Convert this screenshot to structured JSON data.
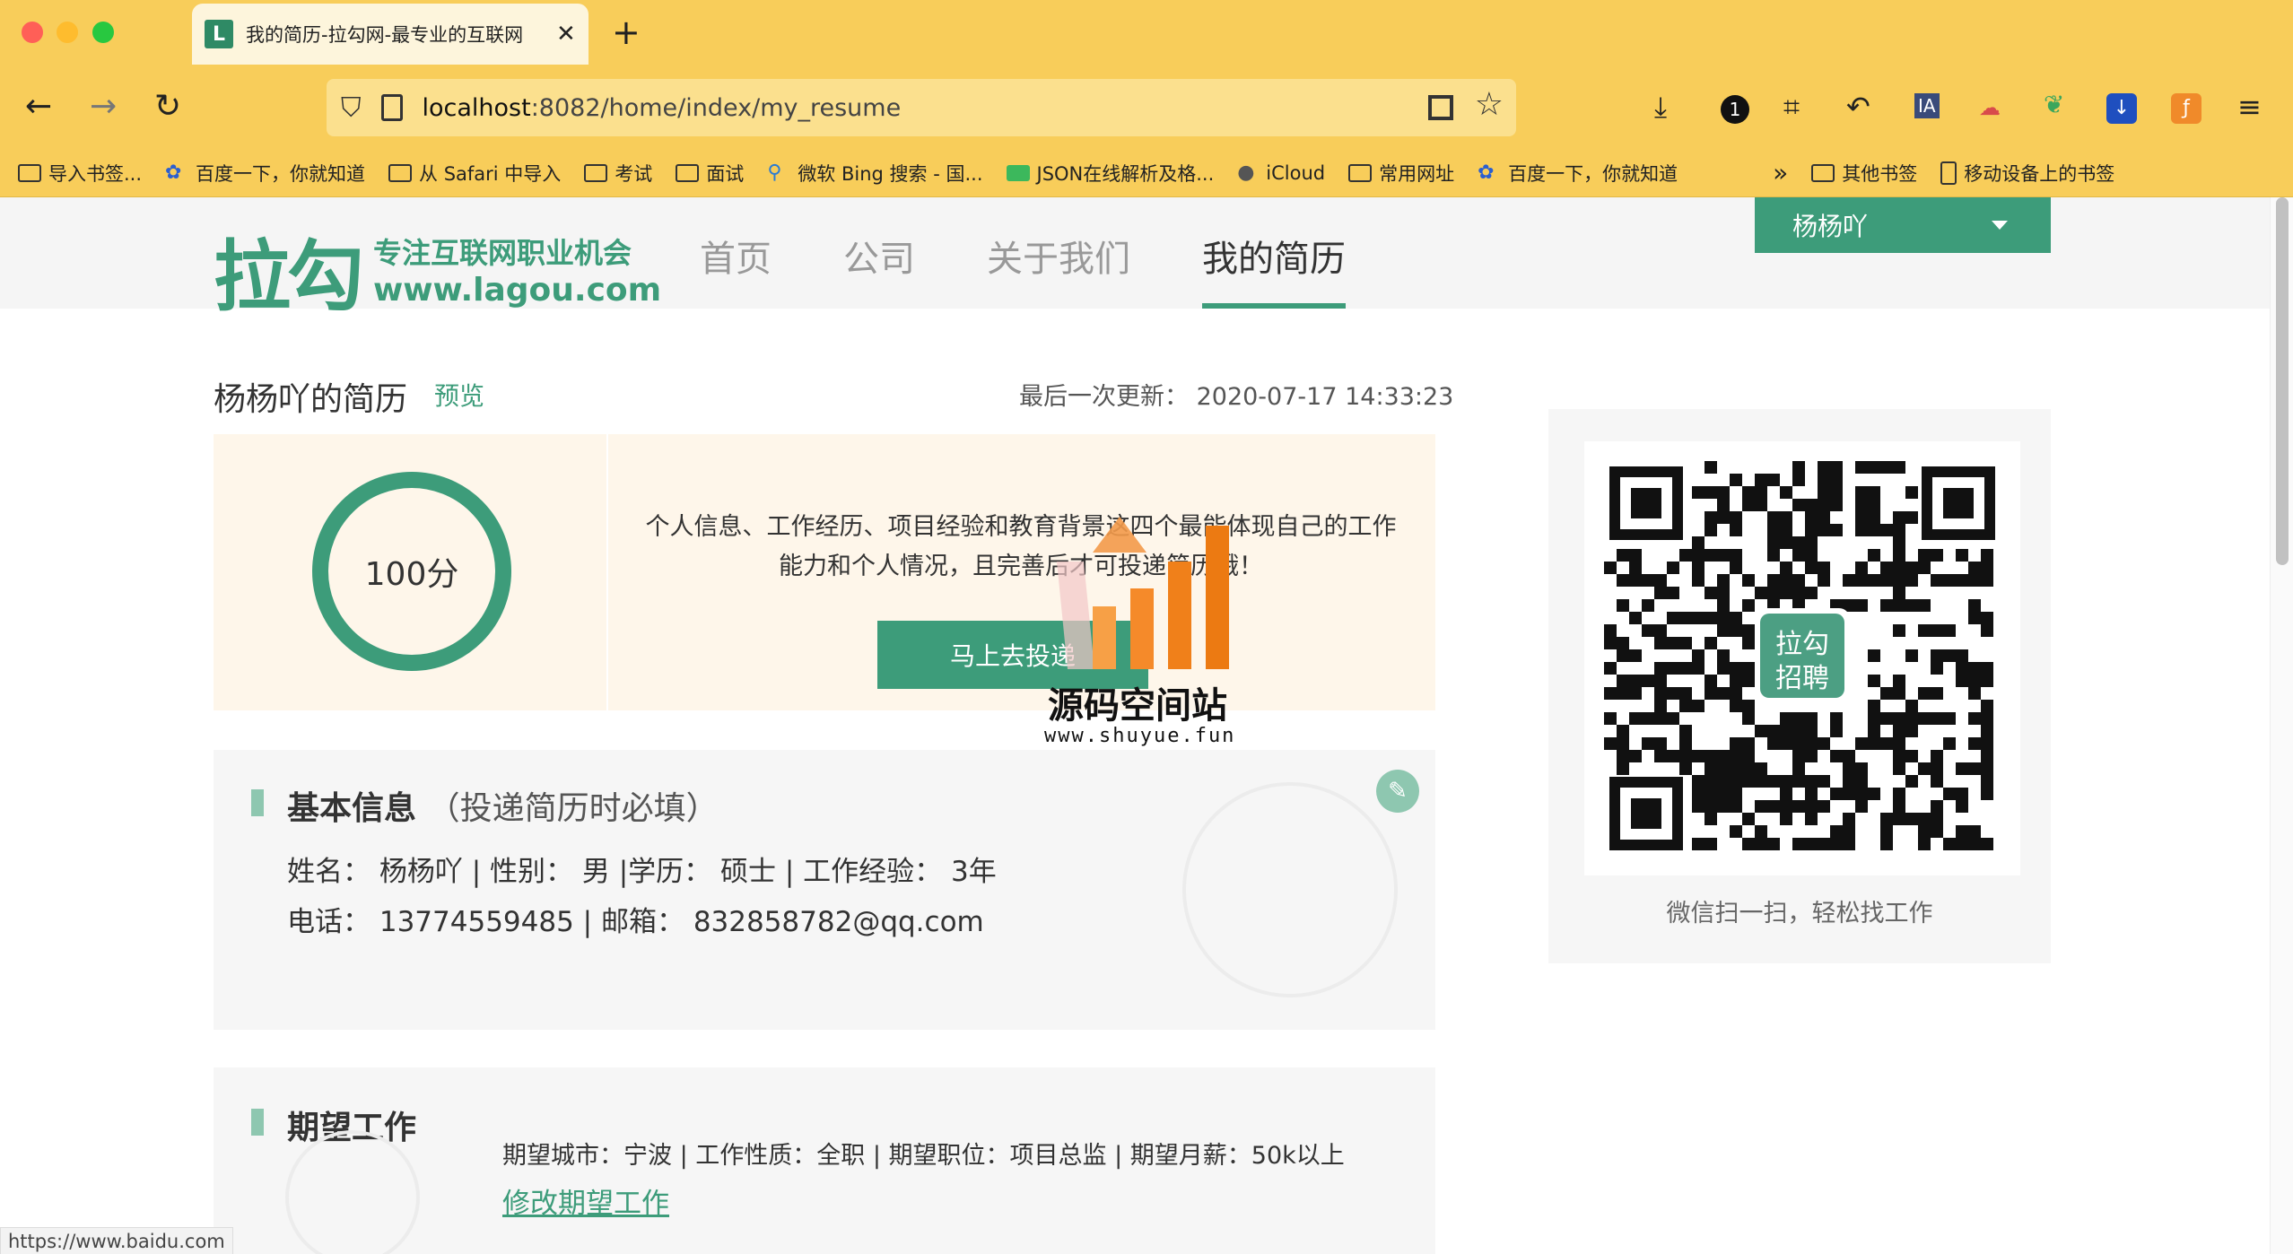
{
  "browser": {
    "tab_title": "我的简历-拉勾网-最专业的互联网",
    "tab_favicon": "L",
    "url_host": "localhost",
    "url_rest": ":8082/home/index/my_resume",
    "status_url": "https://www.baidu.com",
    "bookmarks": [
      {
        "label": "导入书签...",
        "icon": "import-icon"
      },
      {
        "label": "百度一下，你就知道",
        "icon": "paw-icon"
      },
      {
        "label": "从 Safari 中导入",
        "icon": "folder-icon"
      },
      {
        "label": "考试",
        "icon": "folder-icon"
      },
      {
        "label": "面试",
        "icon": "folder-icon"
      },
      {
        "label": "微软 Bing 搜索 - 国...",
        "icon": "search-icon"
      },
      {
        "label": "JSON在线解析及格...",
        "icon": "json-icon"
      },
      {
        "label": "iCloud",
        "icon": "apple-icon"
      },
      {
        "label": "常用网址",
        "icon": "folder-icon"
      },
      {
        "label": "百度一下，你就知道",
        "icon": "paw-icon"
      }
    ],
    "bookmarks_overflow": "»",
    "bookmark_other": "其他书签",
    "bookmark_mobile": "移动设备上的书签"
  },
  "site": {
    "logo_big": "拉勾",
    "logo_slogan": "专注互联网职业机会",
    "logo_url": "www.lagou.com",
    "nav": [
      "首页",
      "公司",
      "关于我们",
      "我的简历"
    ],
    "user_name": "杨杨吖"
  },
  "resume": {
    "heading": "杨杨吖的简历",
    "preview": "预览",
    "last_update_label": "最后一次更新：",
    "last_update_value": "2020-07-17 14:33:23",
    "score": "100分",
    "score_desc_line1": "个人信息、工作经历、项目经验和教育背景这四个最能体现自己的工作",
    "score_desc_line2": "能力和个人情况，且完善后才可投递简历哦！",
    "deliver_button": "马上去投递",
    "basic_title": "基本信息",
    "basic_note": "（投递简历时必填）",
    "basic_line1": "姓名：  杨杨吖 | 性别：  男 |学历：  硕士 | 工作经验：  3年",
    "basic_line2": "电话：  13774559485 | 邮箱：  832858782@qq.com",
    "expect_title": "期望工作",
    "expect_line": "期望城市：宁波 | 工作性质：全职 | 期望职位：项目总监 | 期望月薪：50k以上",
    "expect_edit": "修改期望工作"
  },
  "qr": {
    "center_label_1": "拉勾",
    "center_label_2": "招聘",
    "caption": "微信扫一扫，轻松找工作"
  },
  "watermark": {
    "title": "源码空间站",
    "url": "www.shuyue.fun"
  }
}
